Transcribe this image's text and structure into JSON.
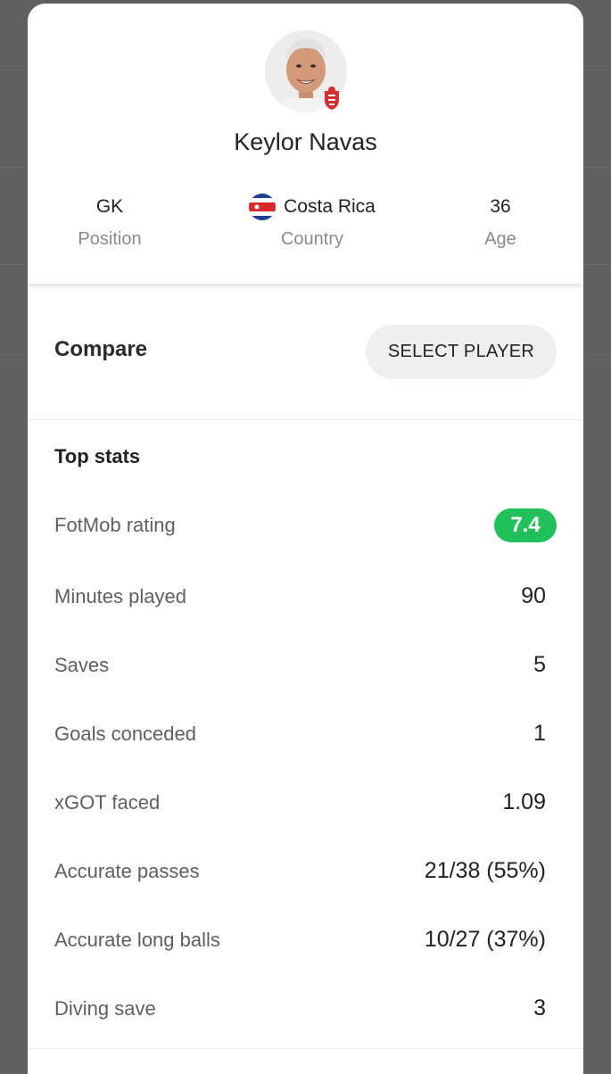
{
  "player": {
    "name": "Keylor Navas",
    "position_value": "GK",
    "position_label": "Position",
    "country_value": "Costa Rica",
    "country_label": "Country",
    "age_value": "36",
    "age_label": "Age",
    "avatar_icon": "player-photo",
    "club_badge_icon": "nottingham-forest-badge",
    "flag_icon": "costa-rica-flag"
  },
  "compare": {
    "label": "Compare",
    "button_label": "SELECT PLAYER"
  },
  "top_stats": {
    "title": "Top stats",
    "rows": [
      {
        "label": "FotMob rating",
        "value": "7.4"
      },
      {
        "label": "Minutes played",
        "value": "90"
      },
      {
        "label": "Saves",
        "value": "5"
      },
      {
        "label": "Goals conceded",
        "value": "1"
      },
      {
        "label": "xGOT faced",
        "value": "1.09"
      },
      {
        "label": "Accurate passes",
        "value": "21/38 (55%)"
      },
      {
        "label": "Accurate long balls",
        "value": "10/27 (37%)"
      },
      {
        "label": "Diving save",
        "value": "3"
      }
    ]
  },
  "colors": {
    "rating_green": "#22c05a",
    "backdrop": "#606060",
    "flag_blue": "#1f3f95",
    "flag_red": "#d52b2b"
  }
}
